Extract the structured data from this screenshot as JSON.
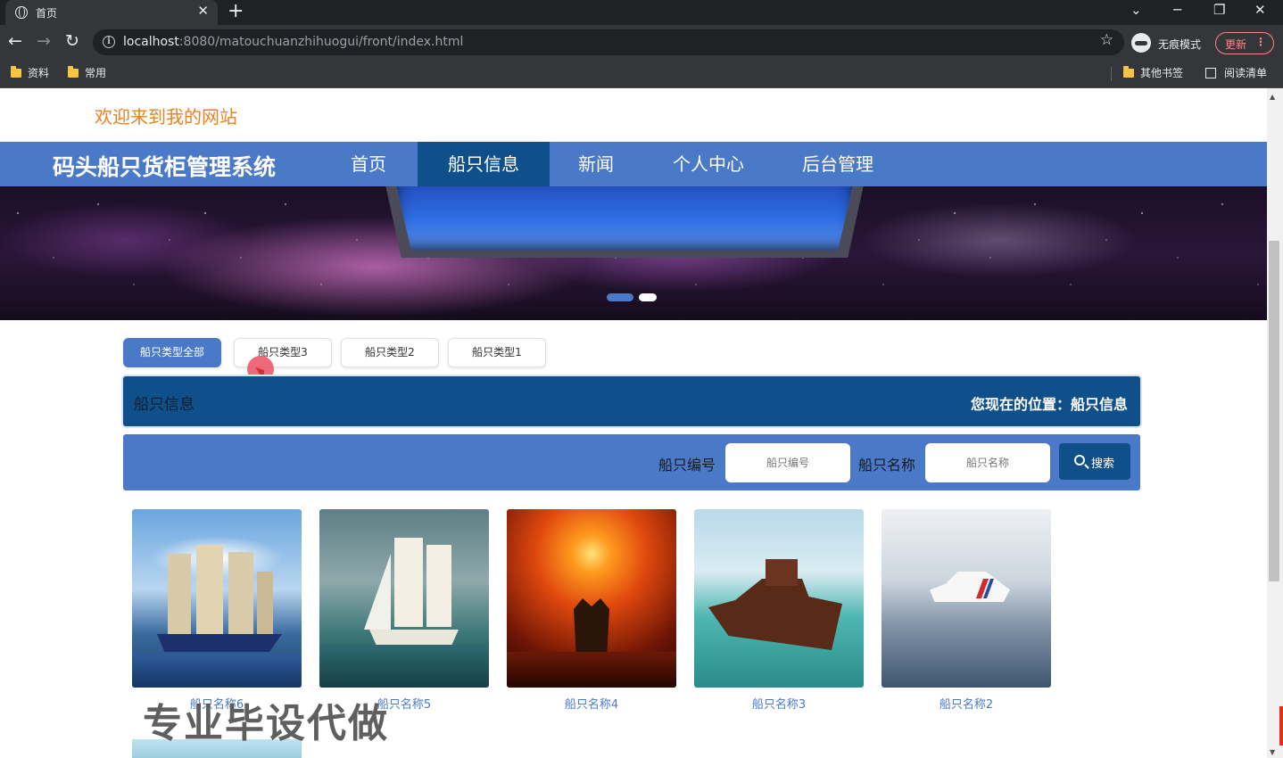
{
  "browser": {
    "tab_title": "首页",
    "url_host": "localhost",
    "url_rest": ":8080/matouchuanzhihuogui/front/index.html",
    "profile_label": "无痕模式",
    "update_label": "更新",
    "bookmarks": [
      "资料",
      "常用"
    ],
    "bookmarks_right": [
      "其他书签",
      "阅读清单"
    ]
  },
  "site": {
    "welcome": "欢迎来到我的网站",
    "title": "码头船只货柜管理系统",
    "nav": [
      "首页",
      "船只信息",
      "新闻",
      "个人中心",
      "后台管理"
    ],
    "active_nav": "船只信息"
  },
  "banner": {
    "slide_count": 2,
    "active_slide": 1
  },
  "type_tabs": [
    "船只类型全部",
    "船只类型3",
    "船只类型2",
    "船只类型1"
  ],
  "active_type_tab": "船只类型全部",
  "location_bar": {
    "title": "船只信息",
    "breadcrumb": "您现在的位置：船只信息"
  },
  "search": {
    "field1_label": "船只编号",
    "field1_placeholder": "船只编号",
    "field2_label": "船只名称",
    "field2_placeholder": "船只名称",
    "button_label": "搜索"
  },
  "ships": [
    {
      "name": "船只名称6"
    },
    {
      "name": "船只名称5"
    },
    {
      "name": "船只名称4"
    },
    {
      "name": "船只名称3"
    },
    {
      "name": "船只名称2"
    }
  ],
  "watermark": "专业毕设代做",
  "colors": {
    "nav_blue": "#4a7ac7",
    "nav_active": "#10508a",
    "welcome_orange": "#e9821f"
  }
}
